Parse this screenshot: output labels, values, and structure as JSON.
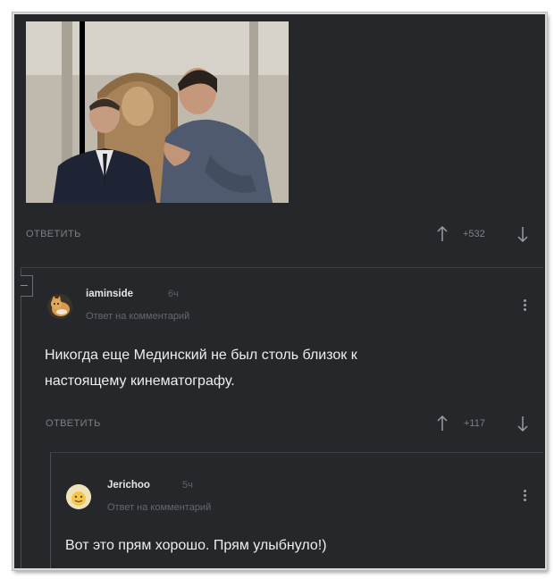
{
  "post": {
    "photo_alt": "",
    "reply_label": "ОТВЕТИТЬ",
    "rating": "+532"
  },
  "comments": [
    {
      "username": "iaminside",
      "time": "6ч",
      "reply_to": "Ответ на комментарий",
      "text_line1": "Никогда еще Мединский не был столь близок к",
      "text_line2": "настоящему кинематографу.",
      "reply_label": "ОТВЕТИТЬ",
      "rating": "+117"
    },
    {
      "username": "Jerichoo",
      "time": "5ч",
      "reply_to": "Ответ на комментарий",
      "text_line1": "Вот это прям хорошо. Прям улыбнуло!)"
    }
  ],
  "icons": {
    "up": "arrow-up-icon",
    "down": "arrow-down-icon",
    "menu": "kebab-menu-icon",
    "collapse": "collapse-thread-icon"
  },
  "colors": {
    "background": "#25272b",
    "text": "#eceef0",
    "muted": "#7c7f83"
  }
}
